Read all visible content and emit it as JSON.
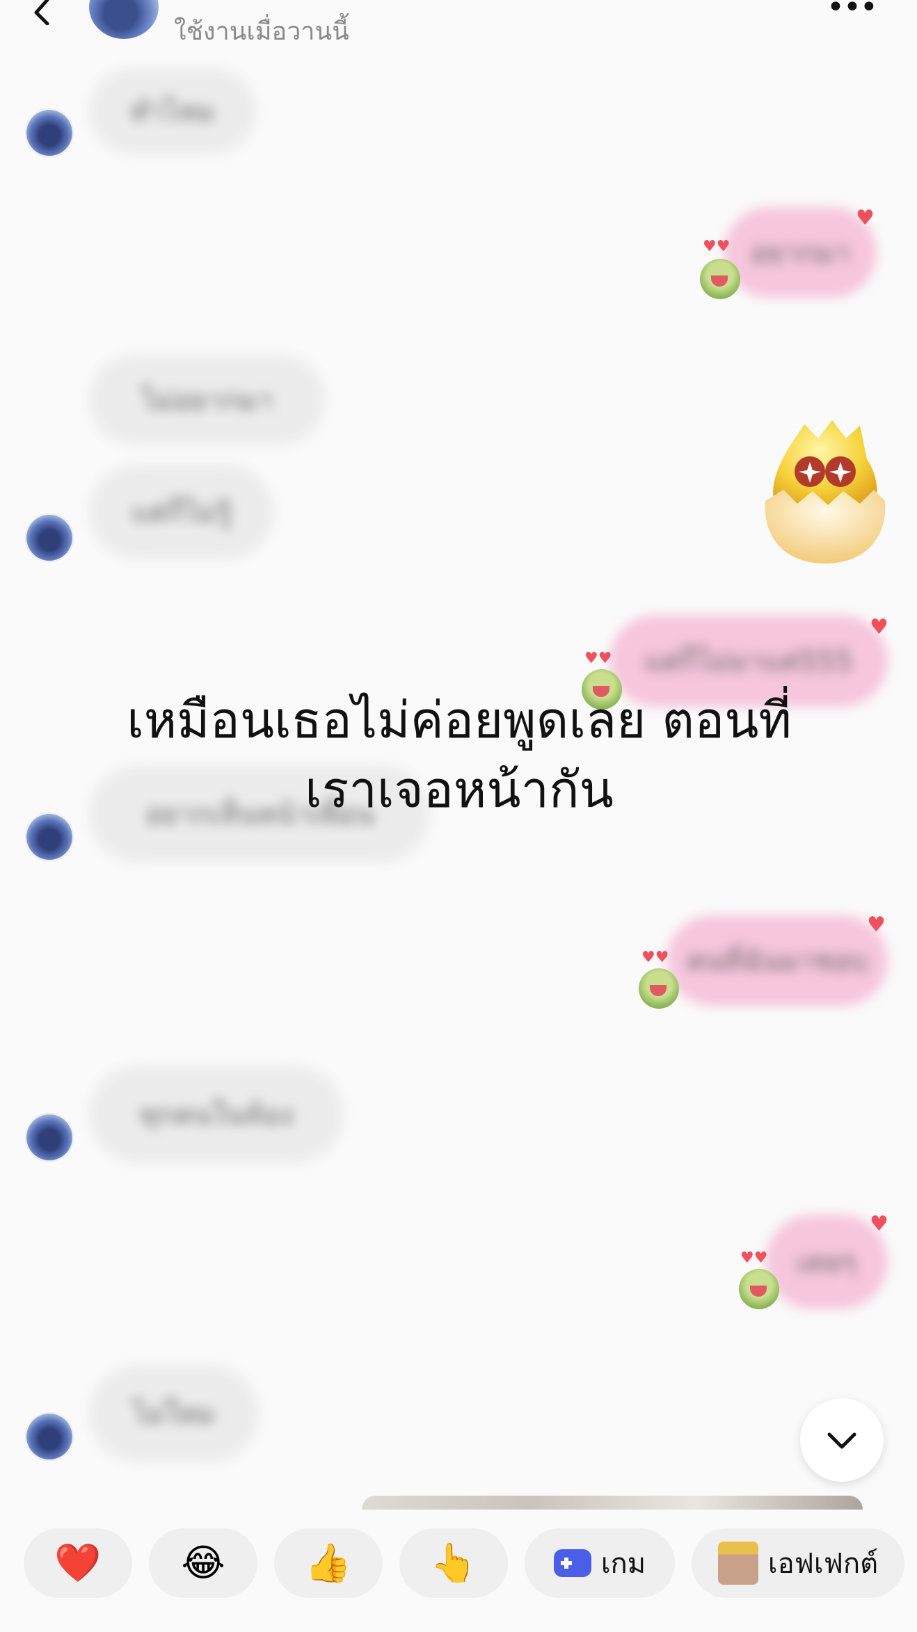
{
  "header": {
    "contact_name": "",
    "status": "ใช้งานเมื่อวานนี้",
    "back_icon": "chevron-left-icon",
    "more_icon": "more-horizontal-icon"
  },
  "messages": [
    {
      "side": "in",
      "text": "ทำไหม"
    },
    {
      "side": "out",
      "text": "อยากมา"
    },
    {
      "side": "in",
      "text": "ไม่อยากมา"
    },
    {
      "side": "in",
      "text": "แต่ก็ไม่รู้"
    },
    {
      "side": "out",
      "text": "แต่ก็ไม่มาแต่555"
    },
    {
      "side": "in",
      "text": "อยากเห็นหน้าเพื่อน"
    },
    {
      "side": "out",
      "text": "คนที่ฉันมาชอบ"
    },
    {
      "side": "in",
      "text": "ทุกคนในห้อง"
    },
    {
      "side": "out",
      "text": "เคยๆ"
    },
    {
      "side": "in",
      "text": "ไม่ใหม"
    }
  ],
  "overlay_caption": {
    "line1": "เหมือนเธอไม่ค่อยพูดเลย ตอนที่",
    "line2": "เราเจอหน้ากัน"
  },
  "quick_bar": [
    {
      "emoji": "❤️",
      "icon": "heart-icon"
    },
    {
      "emoji": "😂",
      "icon": "laughing-emoji-icon"
    },
    {
      "emoji": "👍",
      "icon": "thumbs-up-icon"
    },
    {
      "emoji": "👆",
      "icon": "pointing-hand-icon"
    },
    {
      "label": "เกม",
      "icon": "gamepad-icon"
    },
    {
      "label": "เอฟเฟกต์",
      "icon": "effect-thumbnail-icon"
    }
  ],
  "colors": {
    "incoming_bubble": "#ececec",
    "outgoing_bubble": "#f6c6dc",
    "background": "#fafafa"
  }
}
